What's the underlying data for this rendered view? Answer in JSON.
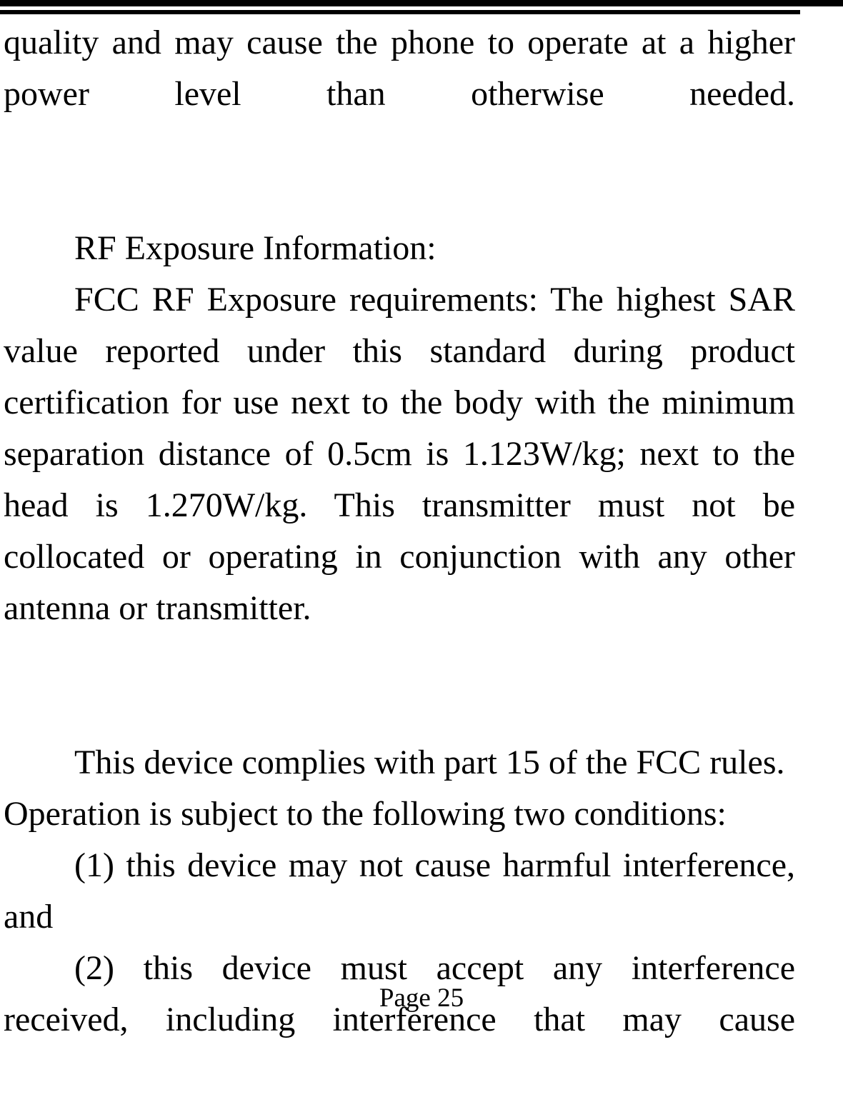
{
  "document": {
    "header_rule": {
      "name": "double-horizontal-rule",
      "color": "#000000"
    },
    "body": {
      "paragraph_1_continued": "quality and may cause the phone to operate at a higher power level than otherwise needed.",
      "rf_exposure_heading": "RF Exposure Information:",
      "rf_exposure_body": "FCC RF Exposure requirements: The highest SAR value reported under this standard during product certification for use next to the body with the minimum separation distance of 0.5cm is 1.123W/kg; next to the head is 1.270W/kg. This transmitter must not be collocated or operating in conjunction with any other antenna or transmitter.",
      "fcc_part15_intro_line1": "This device complies with part 15 of the FCC rules.",
      "fcc_part15_intro_line2": "Operation is subject to the following two conditions:",
      "condition_1": "(1) this device may not cause harmful interference, and",
      "condition_2": "(2) this device must accept any interference received, including interference that may cause"
    },
    "footer": {
      "page_number": "Page 25"
    },
    "values": {
      "sar_body": "1.123W/kg",
      "sar_head": "1.270W/kg",
      "separation_distance": "0.5cm",
      "fcc_part": "part 15"
    }
  }
}
